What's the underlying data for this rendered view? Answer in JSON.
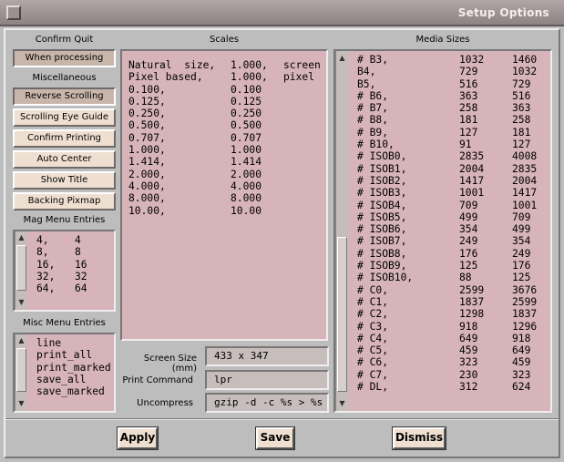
{
  "window": {
    "title": "Setup Options"
  },
  "left": {
    "confirm_quit_label": "Confirm Quit",
    "when_processing": "When processing",
    "misc_label": "Miscellaneous",
    "buttons": [
      "Reverse Scrolling",
      "Scrolling Eye Guide",
      "Confirm Printing",
      "Auto Center",
      "Show Title",
      "Backing Pixmap"
    ],
    "mag_label": "Mag Menu Entries",
    "mag_entries": [
      [
        "4,",
        "4"
      ],
      [
        "8,",
        "8"
      ],
      [
        "16,",
        "16"
      ],
      [
        "32,",
        "32"
      ],
      [
        "64,",
        "64"
      ]
    ],
    "misc_menu_label": "Misc Menu Entries",
    "misc_entries": [
      "line",
      "print_all",
      "print_marked",
      "save_all",
      "save_marked"
    ]
  },
  "scales": {
    "label": "Scales",
    "rows": [
      [
        "Natural  size,",
        "1.000,",
        "screen"
      ],
      [
        "Pixel based,",
        "1.000,",
        "pixel"
      ],
      [
        "0.100,",
        "0.100",
        ""
      ],
      [
        "0.125,",
        "0.125",
        ""
      ],
      [
        "0.250,",
        "0.250",
        ""
      ],
      [
        "0.500,",
        "0.500",
        ""
      ],
      [
        "0.707,",
        "0.707",
        ""
      ],
      [
        "1.000,",
        "1.000",
        ""
      ],
      [
        "1.414,",
        "1.414",
        ""
      ],
      [
        "2.000,",
        "2.000",
        ""
      ],
      [
        "4.000,",
        "4.000",
        ""
      ],
      [
        "8.000,",
        "8.000",
        ""
      ],
      [
        "10.00,",
        "10.00",
        ""
      ]
    ]
  },
  "fields": {
    "screen_size_label": "Screen Size (mm)",
    "screen_size_value": "433 x 347",
    "print_command_label": "Print Command",
    "print_command_value": "lpr",
    "uncompress_label": "Uncompress",
    "uncompress_value": "gzip -d -c %s > %s"
  },
  "media": {
    "label": "Media Sizes",
    "rows": [
      [
        "# B3,",
        "1032",
        "1460"
      ],
      [
        "B4,",
        "729",
        "1032"
      ],
      [
        "B5,",
        "516",
        "729"
      ],
      [
        "# B6,",
        "363",
        "516"
      ],
      [
        "# B7,",
        "258",
        "363"
      ],
      [
        "# B8,",
        "181",
        "258"
      ],
      [
        "# B9,",
        "127",
        "181"
      ],
      [
        "# B10,",
        "91",
        "127"
      ],
      [
        "# ISOB0,",
        "2835",
        "4008"
      ],
      [
        "# ISOB1,",
        "2004",
        "2835"
      ],
      [
        "# ISOB2,",
        "1417",
        "2004"
      ],
      [
        "# ISOB3,",
        "1001",
        "1417"
      ],
      [
        "# ISOB4,",
        "709",
        "1001"
      ],
      [
        "# ISOB5,",
        "499",
        "709"
      ],
      [
        "# ISOB6,",
        "354",
        "499"
      ],
      [
        "# ISOB7,",
        "249",
        "354"
      ],
      [
        "# ISOB8,",
        "176",
        "249"
      ],
      [
        "# ISOB9,",
        "125",
        "176"
      ],
      [
        "# ISOB10,",
        "88",
        "125"
      ],
      [
        "# C0,",
        "2599",
        "3676"
      ],
      [
        "# C1,",
        "1837",
        "2599"
      ],
      [
        "# C2,",
        "1298",
        "1837"
      ],
      [
        "# C3,",
        "918",
        "1296"
      ],
      [
        "# C4,",
        "649",
        "918"
      ],
      [
        "# C5,",
        "459",
        "649"
      ],
      [
        "# C6,",
        "323",
        "459"
      ],
      [
        "# C7,",
        "230",
        "323"
      ],
      [
        "# DL,",
        "312",
        "624"
      ]
    ]
  },
  "actions": {
    "apply": "Apply",
    "save": "Save",
    "dismiss": "Dismiss"
  }
}
